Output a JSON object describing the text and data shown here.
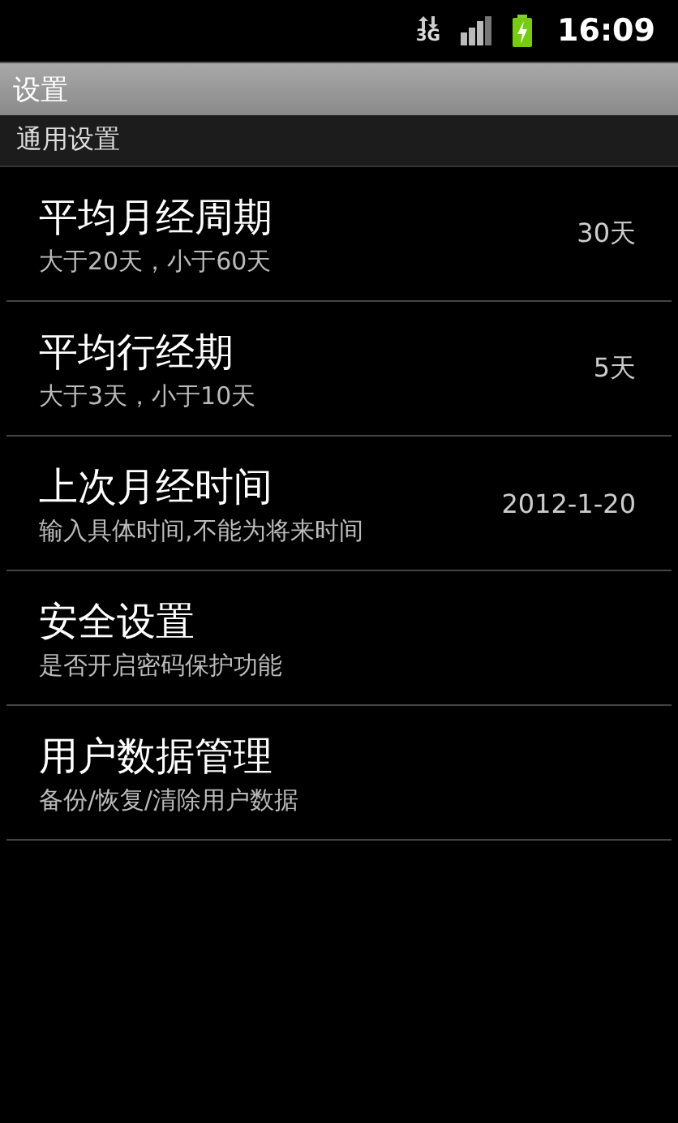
{
  "status_bar": {
    "network": "3G",
    "time": "16:09"
  },
  "title_bar": {
    "title": "设置"
  },
  "section": {
    "title": "通用设置"
  },
  "items": [
    {
      "title": "平均月经周期",
      "summary": "大于20天，小于60天",
      "value": "30天"
    },
    {
      "title": "平均行经期",
      "summary": "大于3天，小于10天",
      "value": "5天"
    },
    {
      "title": "上次月经时间",
      "summary": "输入具体时间,不能为将来时间",
      "value": "2012-1-20"
    },
    {
      "title": "安全设置",
      "summary": "是否开启密码保护功能"
    },
    {
      "title": "用户数据管理",
      "summary": "备份/恢复/清除用户数据"
    }
  ]
}
